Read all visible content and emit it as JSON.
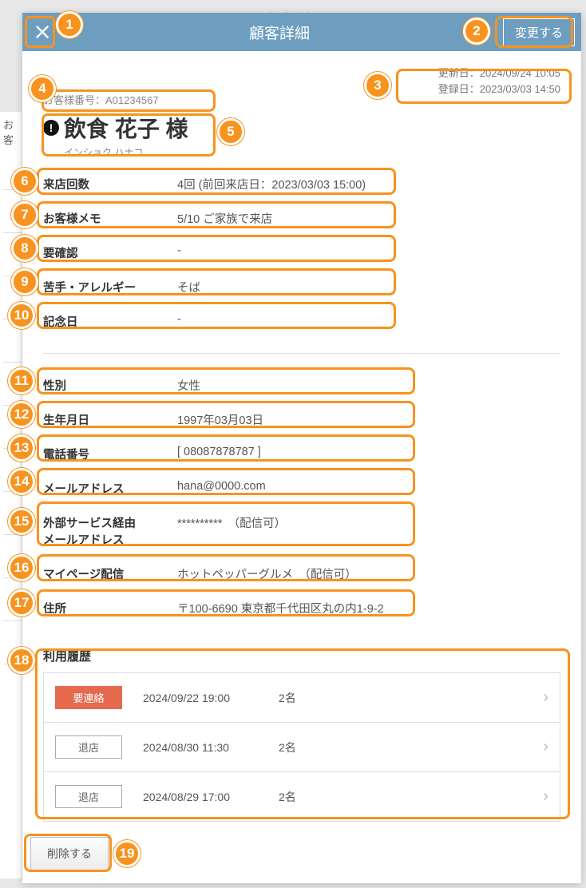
{
  "background_title": "顧客台帳",
  "sidebar_stub": "お客",
  "header": {
    "title": "顧客詳細",
    "change_button": "変更する"
  },
  "dates": {
    "updated_label": "更新日：",
    "updated_value": "2024/09/24 10:05",
    "created_label": "登録日：",
    "created_value": "2023/03/03 14:50"
  },
  "customer": {
    "number_label": "お客様番号：",
    "number_value": "A01234567",
    "name": "飲食 花子 様",
    "kana": "インショク ハナコ",
    "alert_mark": "!"
  },
  "info_rows_1": [
    {
      "label": "来店回数",
      "value": "4回 (前回来店日：2023/03/03 15:00)"
    },
    {
      "label": "お客様メモ",
      "value": "5/10 ご家族で来店"
    },
    {
      "label": "要確認",
      "value": "-"
    },
    {
      "label": "苦手・アレルギー",
      "value": "そば"
    },
    {
      "label": "記念日",
      "value": "-"
    }
  ],
  "info_rows_2": [
    {
      "label": "性別",
      "value": "女性"
    },
    {
      "label": "生年月日",
      "value": "1997年03月03日"
    },
    {
      "label": "電話番号",
      "value": "[ 08087878787 ]"
    },
    {
      "label": "メールアドレス",
      "value": "hana@0000.com"
    },
    {
      "label": "外部サービス経由\nメールアドレス",
      "value": "**********　（配信可）"
    },
    {
      "label": "マイページ配信",
      "value": "ホットペッパーグルメ　（配信可）"
    },
    {
      "label": "住所",
      "value": "〒100-6690 東京都千代田区丸の内1-9-2"
    }
  ],
  "history": {
    "title": "利用履歴",
    "items": [
      {
        "tag": "要連絡",
        "tag_color": "red",
        "date": "2024/09/22 19:00",
        "people": "2名"
      },
      {
        "tag": "退店",
        "tag_color": "gray",
        "date": "2024/08/30 11:30",
        "people": "2名"
      },
      {
        "tag": "退店",
        "tag_color": "gray",
        "date": "2024/08/29 17:00",
        "people": "2名"
      }
    ]
  },
  "footer": {
    "delete_button": "削除する"
  },
  "annotations": [
    1,
    2,
    3,
    4,
    5,
    6,
    7,
    8,
    9,
    10,
    11,
    12,
    13,
    14,
    15,
    16,
    17,
    18,
    19
  ]
}
